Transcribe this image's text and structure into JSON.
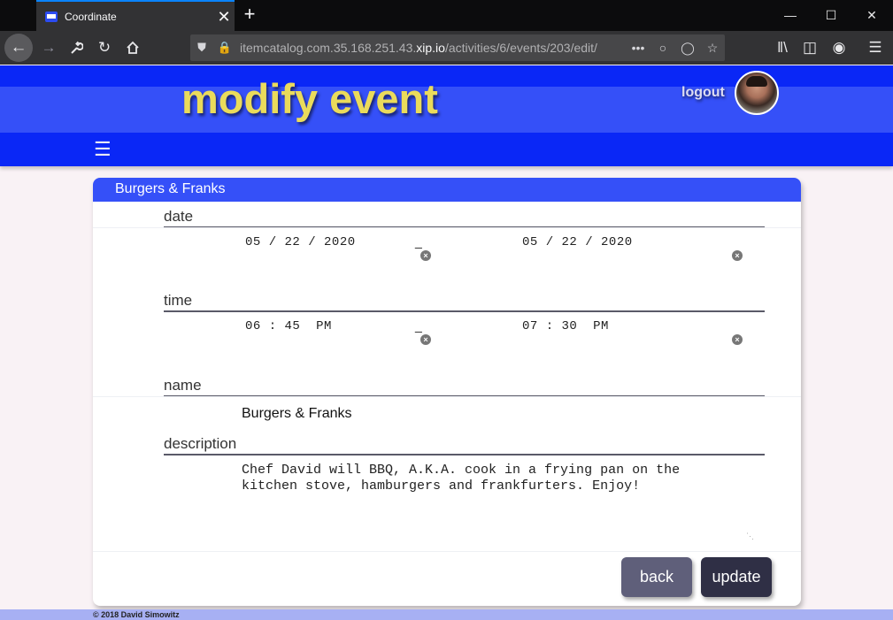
{
  "browser": {
    "tab_title": "Coordinate",
    "tab_close": "✕",
    "new_tab": "+",
    "url_prefix": "itemcatalog.com.35.168.251.43.",
    "url_host": "xip.io",
    "url_path": "/activities/6/events/203/edit/",
    "window_controls": {
      "minimize": "—",
      "maximize": "☐",
      "close": "✕"
    }
  },
  "header": {
    "title": "modify event",
    "logout_label": "logout",
    "menu_glyph": "☰"
  },
  "card": {
    "title": "Burgers & Franks",
    "date": {
      "label": "date",
      "start": "05 / 22 / 2020",
      "end": "05 / 22 / 2020",
      "separator": "_"
    },
    "time": {
      "label": "time",
      "start": "06 : 45  PM",
      "end": "07 : 30  PM",
      "separator": "_"
    },
    "name": {
      "label": "name",
      "value": "Burgers & Franks"
    },
    "description": {
      "label": "description",
      "value": "Chef David will BBQ, A.K.A. cook in a frying pan on the kitchen stove, hamburgers and frankfurters. Enjoy!"
    },
    "back_label": "back",
    "update_label": "update"
  },
  "footer": {
    "copyright": "© 2018 David Simowitz"
  },
  "icons": [
    "back-arrow-icon",
    "forward-arrow-icon",
    "wrench-icon",
    "reload-icon",
    "home-icon",
    "tracking-shield-icon",
    "insecure-lock-icon",
    "more-icon",
    "lightbulb-icon",
    "pocket-icon",
    "bookmark-star-icon",
    "library-icon",
    "sidebar-icon",
    "account-icon",
    "menu-icon",
    "clear-icon"
  ],
  "colors": {
    "header_blue": "#0a27f6",
    "header_light_blue": "#3550f8",
    "title_yellow": "#eadb5b",
    "back_button": "#5f5f7a",
    "update_button": "#2f2f45"
  }
}
